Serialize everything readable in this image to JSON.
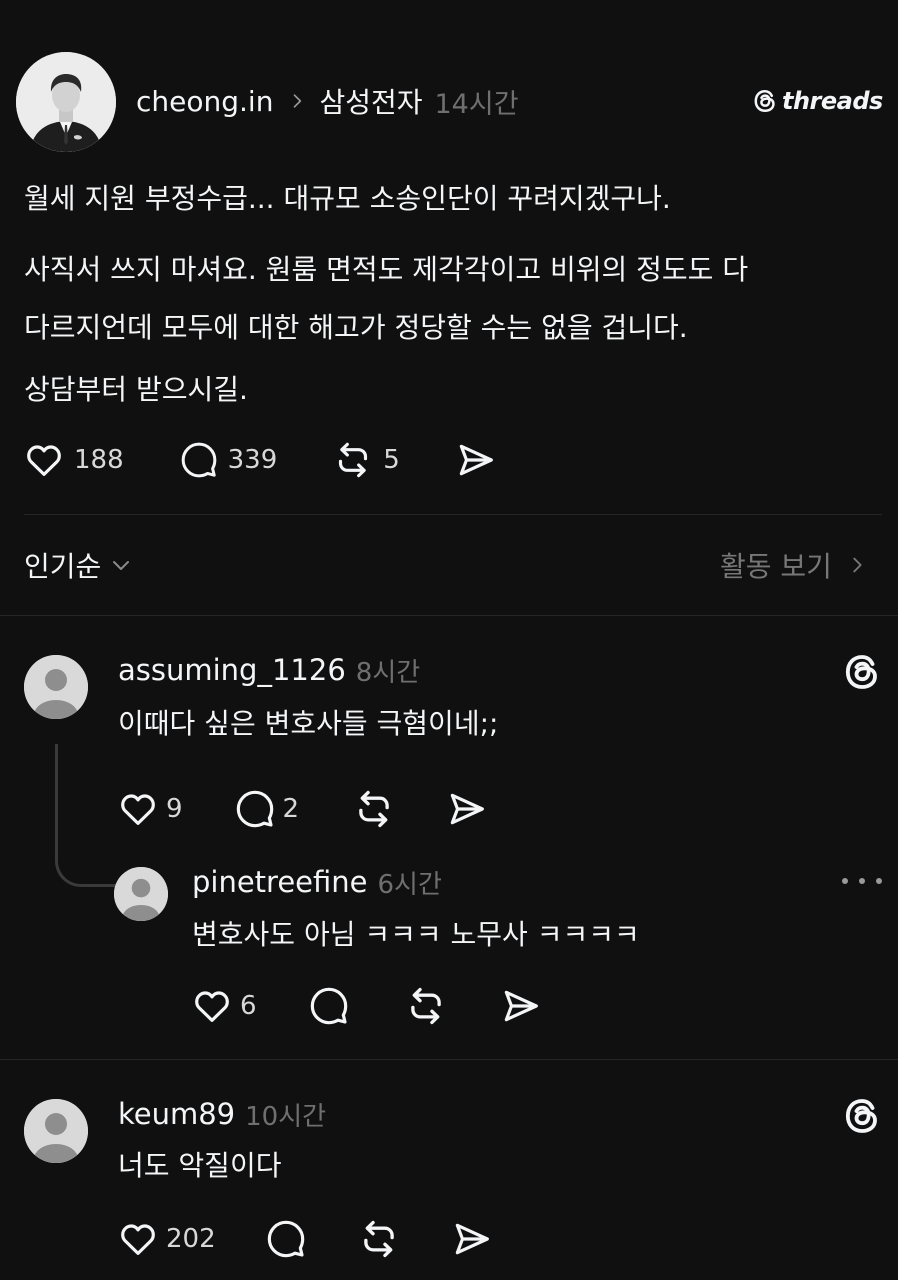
{
  "post": {
    "username": "cheong.in",
    "community": "삼성전자",
    "time": "14시간",
    "brand": "threads",
    "paragraphs": [
      "월세 지원 부정수급... 대규모 소송인단이 꾸려지겠구나.",
      "사직서 쓰지 마셔요. 원룸 면적도 제각각이고 비위의 정도도 다르지언데 모두에 대한 해고가 정당할 수는 없을 겁니다.",
      "상담부터 받으시길."
    ],
    "paragraph_lines": [
      [
        "월세 지원 부정수급... 대규모 소송인단이 꾸려지겠구나."
      ],
      [
        "사직서 쓰지 마셔요. 원룸 면적도 제각각이고 비위의 정도도 다",
        "다르지언데 모두에 대한 해고가 정당할 수는 없을 겁니다."
      ],
      [
        "상담부터 받으시길."
      ]
    ],
    "likes": "188",
    "comments": "339",
    "reposts": "5"
  },
  "sort": {
    "label": "인기순",
    "activity": "활동 보기"
  },
  "replies": [
    {
      "username": "assuming_1126",
      "time": "8시간",
      "text": "이때다 싶은 변호사들 극혐이네;;",
      "likes": "9",
      "comments": "2"
    },
    {
      "username": "pinetreefine",
      "time": "6시간",
      "text": "변호사도 아님 ㅋㅋㅋ 노무사 ㅋㅋㅋㅋ",
      "likes": "6"
    },
    {
      "username": "keum89",
      "time": "10시간",
      "text": "너도 악질이다",
      "likes": "202"
    }
  ],
  "icons": {
    "separator": "chevron-right-icon",
    "like": "heart-icon",
    "comment": "comment-icon",
    "repost": "repost-icon",
    "share": "send-icon",
    "more": "more-icon",
    "threads": "threads-icon"
  },
  "colors": {
    "background": "#101010",
    "text": "#f3f5f7",
    "muted": "#6f6f6f",
    "divider": "#262626"
  }
}
